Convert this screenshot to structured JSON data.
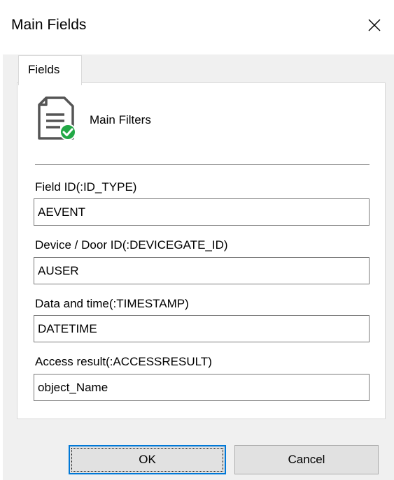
{
  "window": {
    "title": "Main Fields",
    "close_icon": "close-icon"
  },
  "tabs": [
    {
      "label": "Fields",
      "selected": true
    }
  ],
  "panel": {
    "icon": "document-check-icon",
    "heading": "Main Filters"
  },
  "fields": [
    {
      "label": "Field ID(:ID_TYPE)",
      "value": "AEVENT"
    },
    {
      "label": "Device / Door ID(:DEVICEGATE_ID)",
      "value": "AUSER"
    },
    {
      "label": "Data and time(:TIMESTAMP)",
      "value": "DATETIME"
    },
    {
      "label": "Access result(:ACCESSRESULT)",
      "value": "object_Name"
    }
  ],
  "buttons": {
    "ok_label": "OK",
    "cancel_label": "Cancel"
  },
  "colors": {
    "focus_border": "#0078d7",
    "check_badge": "#22a846"
  }
}
